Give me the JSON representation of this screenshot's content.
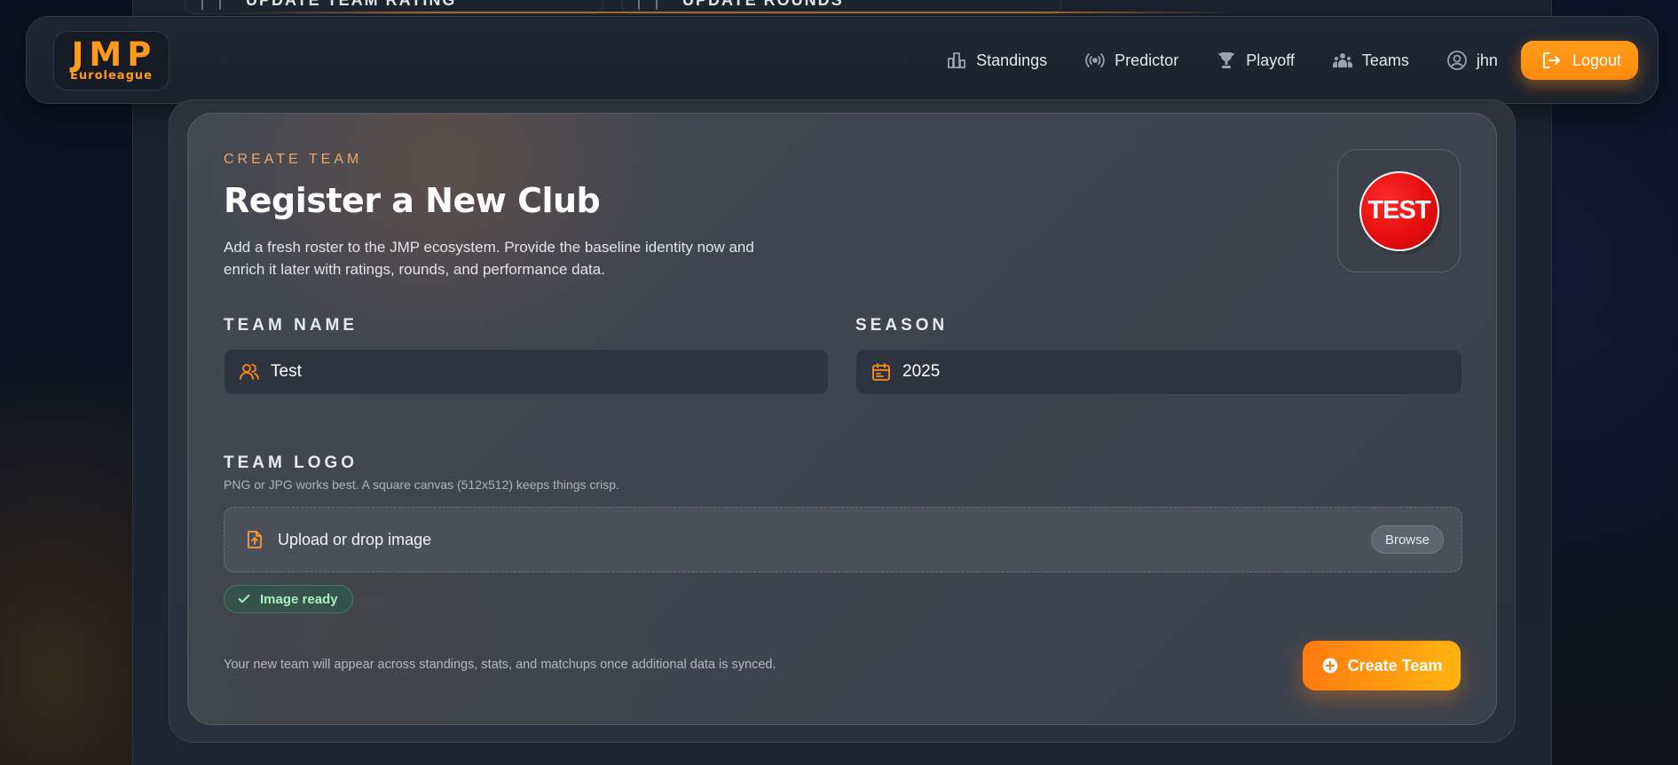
{
  "top_strip": {
    "card1_label": "UPDATE TEAM RATING",
    "card2_label": "UPDATE ROUNDS"
  },
  "brand": {
    "logo_main": "JMP",
    "logo_sub": "Euroleague"
  },
  "nav": {
    "items": [
      {
        "label": "Standings",
        "icon": "building-icon"
      },
      {
        "label": "Predictor",
        "icon": "broadcast-icon"
      },
      {
        "label": "Playoff",
        "icon": "trophy-icon"
      },
      {
        "label": "Teams",
        "icon": "people-icon"
      },
      {
        "label": "jhn",
        "icon": "user-circle-icon"
      }
    ],
    "logout_label": "Logout"
  },
  "form": {
    "eyebrow": "CREATE TEAM",
    "title": "Register a New Club",
    "description": "Add a fresh roster to the JMP ecosystem. Provide the baseline identity now and enrich it later with ratings, rounds, and performance data.",
    "logo_preview_text": "TEST",
    "team_name": {
      "label": "TEAM NAME",
      "value": "Test"
    },
    "season": {
      "label": "SEASON",
      "value": "2025"
    },
    "team_logo": {
      "label": "TEAM LOGO",
      "hint": "PNG or JPG works best. A square canvas (512x512) keeps things crisp.",
      "dropzone_label": "Upload or drop image",
      "browse_label": "Browse",
      "status": "Image ready"
    },
    "footer_note": "Your new team will appear across standings, stats, and matchups once additional data is synced.",
    "submit_label": "Create Team"
  },
  "colors": {
    "accent": "#ff8c1e",
    "success": "#a7efc4",
    "badge_red": "#e60d0d"
  }
}
